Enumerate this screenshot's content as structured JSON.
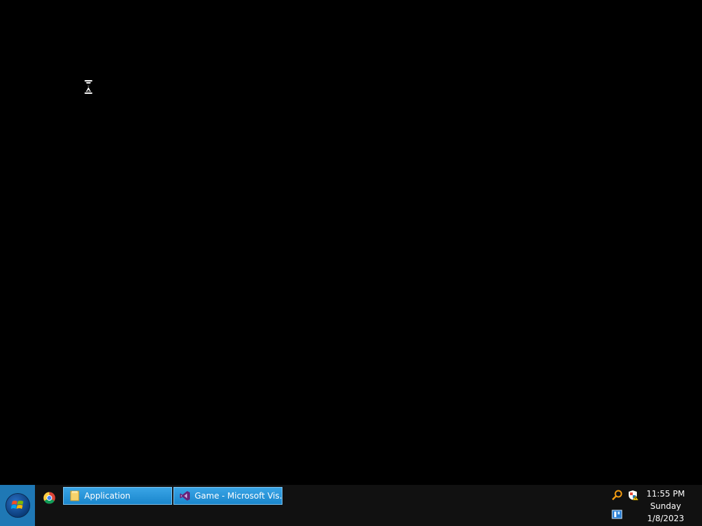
{
  "desktop": {
    "cursor_icon": "hourglass-icon"
  },
  "taskbar": {
    "start_icon": "windows-logo-icon",
    "pinned": [
      {
        "name": "chrome-icon"
      }
    ],
    "tasks": [
      {
        "label": "Application",
        "icon": "folder-icon"
      },
      {
        "label": "Game - Microsoft Vis...",
        "icon": "visual-studio-icon"
      }
    ],
    "tray": {
      "icons": [
        "search-tray-icon",
        "shield-warning-icon",
        "network-tray-icon"
      ],
      "time": "11:55 PM",
      "day": "Sunday",
      "date": "1/8/2023"
    }
  }
}
